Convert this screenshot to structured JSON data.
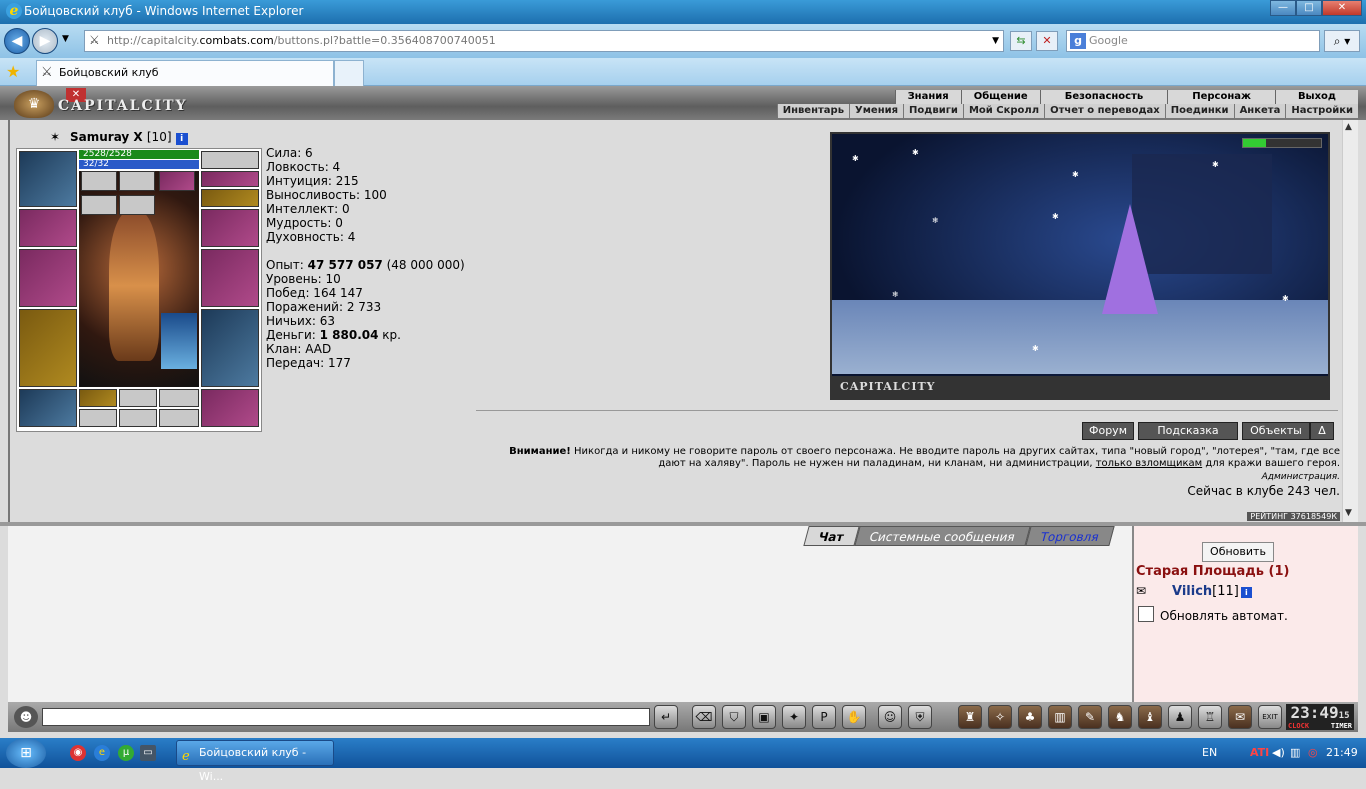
{
  "browser": {
    "window_title": "Бойцовский клуб - Windows Internet Explorer",
    "url_prefix": "http://capitalcity.",
    "url_domain": "combats.com",
    "url_suffix": "/buttons.pl?battle=0.356408700740051",
    "search_placeholder": "Google",
    "tab_title": "Бойцовский клуб"
  },
  "game_header": {
    "logo_text": "CAPITALCITY",
    "main_menu": [
      "Знания",
      "Общение",
      "Безопасность",
      "Персонаж",
      "Выход"
    ],
    "sub_menu": [
      "Инвентарь",
      "Умения",
      "Подвиги",
      "Мой Скролл",
      "Отчет о переводах",
      "Поединки",
      "Анкета",
      "Настройки"
    ]
  },
  "character": {
    "name": "Samuray X",
    "level": "[10]",
    "hp": "2528/2528",
    "mana": "32/32",
    "stats": [
      "Сила: 6",
      "Ловкость: 4",
      "Интуиция: 215",
      "Выносливость: 100",
      "Интеллект: 0",
      "Мудрость: 0",
      "Духовность: 4"
    ],
    "exp_label": "Опыт: ",
    "exp_value": "47 577 057",
    "exp_next": " (48 000 000)",
    "level_line": "Уровень: 10",
    "wins": "Побед: 164 147",
    "losses": "Поражений: 2 733",
    "draws": "Ничьих: 63",
    "money_label": "Деньги: ",
    "money_value": "1 880.04",
    "money_unit": " кр.",
    "clan": "Клан: AAD",
    "transfers": "Передач: 177"
  },
  "location": {
    "caption": "CAPITALCITY"
  },
  "actions": {
    "forum": "Форум",
    "hint": "Подсказка",
    "objects": "Объекты",
    "collapse": "Δ"
  },
  "warning": {
    "bold": "Внимание!",
    "text1": " Никогда и никому не говорите пароль от своего персонажа. Не вводите пароль на других сайтах, типа \"новый город\", \"лотерея\", \"там, где все дают на халяву\". Пароль не нужен ни паладинам, ни кланам, ни администрации, ",
    "underline": "только взломщикам",
    "text2": " для кражи вашего героя.",
    "signature": "Администрация.",
    "online": "Сейчас в клубе 243 чел.",
    "rating": "РЕЙТИНГ 37618549К"
  },
  "chat": {
    "tabs": [
      "Чат",
      "Системные сообщения",
      "Торговля"
    ]
  },
  "room": {
    "refresh_button": "Обновить",
    "name": "Старая Площадь (1)",
    "user_name": "Vilich",
    "user_level": "[11]",
    "auto_refresh": "Обновлять автомат."
  },
  "clock": {
    "time": "23:49",
    "seconds": "15",
    "label_left": "CLOCK",
    "label_right": "TIMER",
    "exit": "EXIT"
  },
  "taskbar": {
    "window_button": "Бойцовский клуб - Wi...",
    "lang": "EN",
    "time": "21:49"
  }
}
